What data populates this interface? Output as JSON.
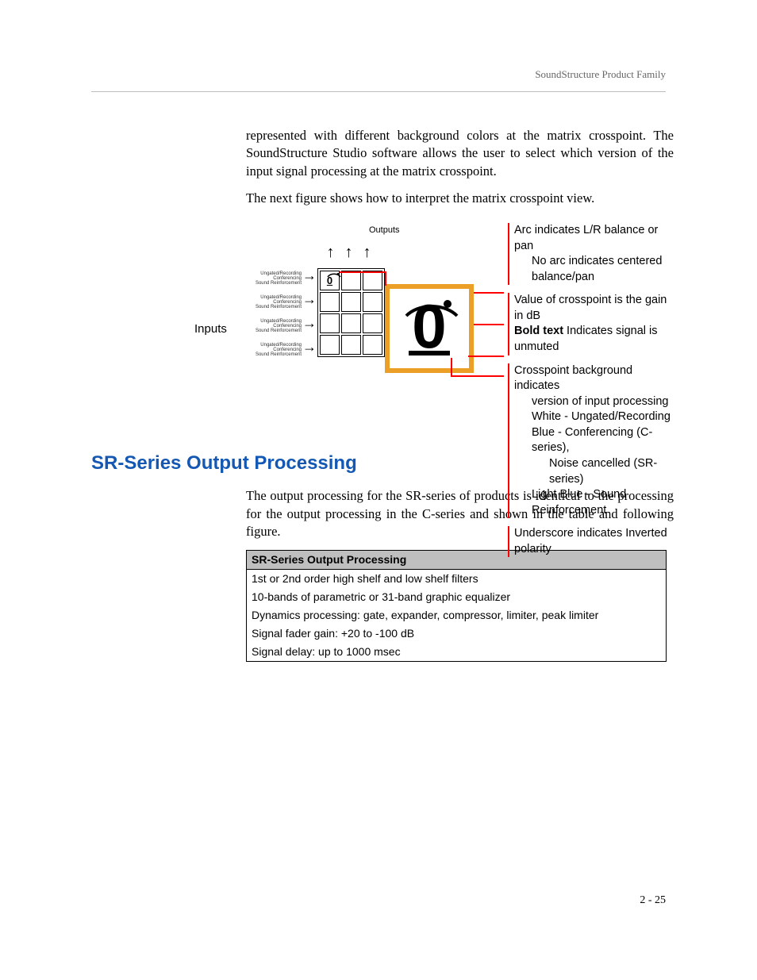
{
  "header": {
    "running_head": "SoundStructure Product Family"
  },
  "body": {
    "p1": "represented with different background colors at the matrix crosspoint. The SoundStructure Studio software allows the user to select which version of the input signal processing at the matrix crosspoint.",
    "p2": "The next figure shows how to interpret the matrix crosspoint view."
  },
  "figure": {
    "outputs_label": "Outputs",
    "inputs_label": "Inputs",
    "row_labels": [
      "Ungated/Recording",
      "Conferencing",
      "Sound Reinforcement"
    ],
    "crosspoint_value": "0",
    "legend": {
      "arc1": "Arc indicates L/R balance or pan",
      "arc2": "No arc indicates centered balance/pan",
      "val1": "Value of crosspoint is the gain in dB",
      "val2_prefix": "Bold text",
      "val2_suffix": " Indicates signal is unmuted",
      "bg1": "Crosspoint background indicates",
      "bg2": "version of input processing",
      "bg3": "White - Ungated/Recording",
      "bg4": "Blue - Conferencing (C-series),",
      "bg5": "Noise cancelled (SR-series)",
      "bg6": "Light Blue - Sound Reinforcement",
      "pol": "Underscore indicates Inverted polarity"
    }
  },
  "section": {
    "heading": "SR-Series Output Processing",
    "para": "The output processing for the SR-series of products is identical to the processing for the output processing in the C-series and shown in the table and following figure.",
    "table": {
      "header": "SR-Series Output Processing",
      "rows": [
        "1st or 2nd order high shelf and low shelf filters",
        "10-bands of parametric or 31-band graphic equalizer",
        "Dynamics processing: gate, expander, compressor, limiter, peak limiter",
        "Signal fader gain: +20 to -100 dB",
        "Signal delay: up to 1000 msec"
      ]
    }
  },
  "footer": {
    "page": "2 - 25"
  }
}
